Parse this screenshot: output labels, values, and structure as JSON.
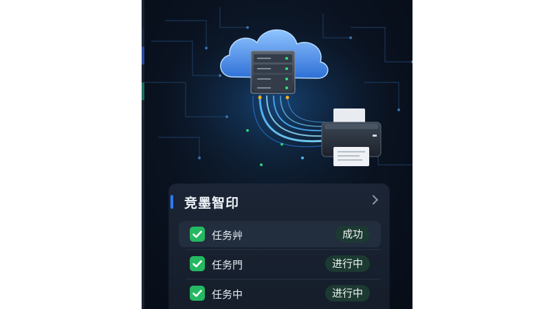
{
  "card": {
    "title": "竞墨智印",
    "tasks": [
      {
        "label": "任务⾋",
        "status": "成功"
      },
      {
        "label": "任务⾨",
        "status": "进行中"
      },
      {
        "label": "任务中",
        "status": "进行中"
      }
    ]
  },
  "colors": {
    "accent": "#2f7bff",
    "check": "#25b862",
    "status_bg": "#1c3a31",
    "background": "#0a1220"
  },
  "icons": [
    "cloud-icon",
    "server-icon",
    "printer-icon",
    "check-icon",
    "chevron-right-icon"
  ]
}
